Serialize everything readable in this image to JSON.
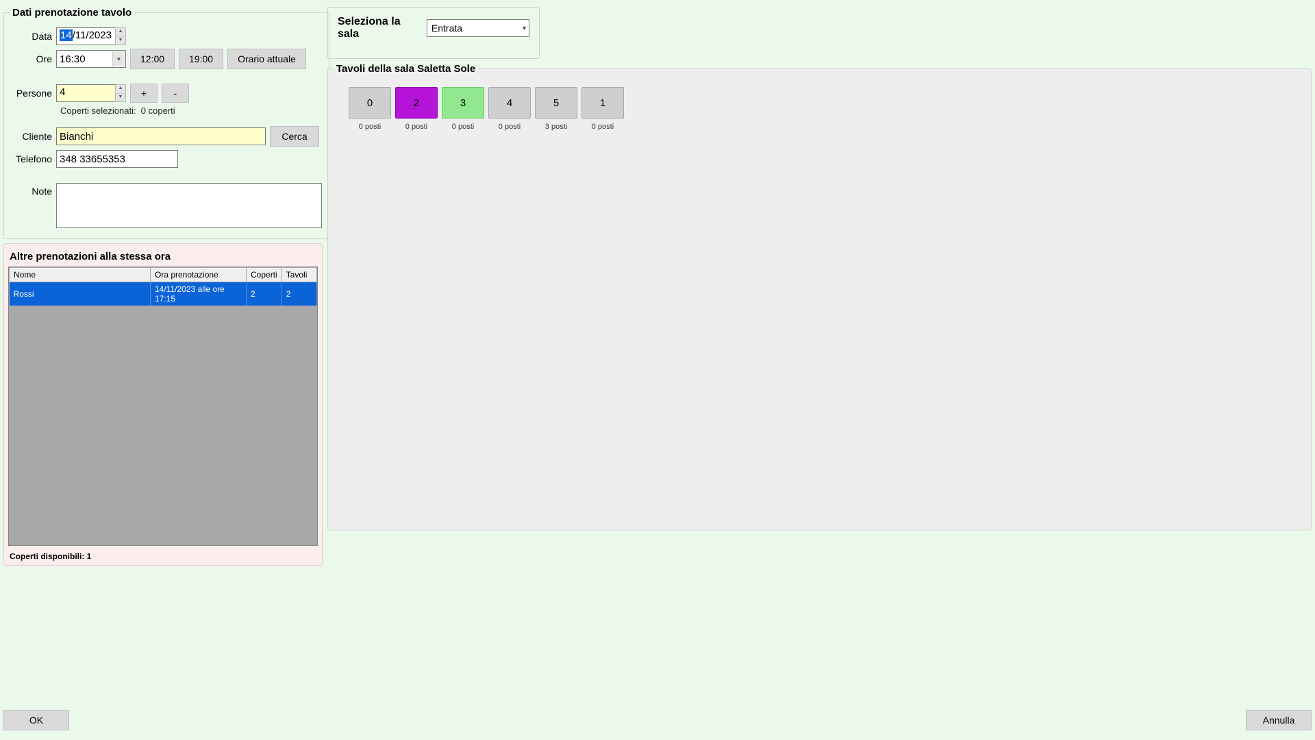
{
  "booking": {
    "section_title": "Dati prenotazione tavolo",
    "date_label": "Data",
    "date_value_sel": "14",
    "date_value_rest": "/11/2023",
    "time_label": "Ore",
    "time_value": "16:30",
    "time_btn_1": "12:00",
    "time_btn_2": "19:00",
    "time_btn_now": "Orario attuale",
    "persons_label": "Persone",
    "persons_value": "4",
    "persons_plus": "+",
    "persons_minus": "-",
    "covers_selected_label": "Coperti selezionati:",
    "covers_selected_value": "0 coperti",
    "client_label": "Cliente",
    "client_value": "Bianchi",
    "search_btn": "Cerca",
    "phone_label": "Telefono",
    "phone_value": "348 33655353",
    "notes_label": "Note",
    "notes_value": ""
  },
  "other": {
    "section_title": "Altre prenotazioni alla stessa ora",
    "col_name": "Nome",
    "col_time": "Ora prenotazione",
    "col_covers": "Coperti",
    "col_tables": "Tavoli",
    "rows": [
      {
        "name": "Rossi",
        "time": "14/11/2023 alle ore 17:15",
        "covers": "2",
        "tables": "2"
      }
    ],
    "available_label": "Coperti disponibili:",
    "available_value": "1"
  },
  "room": {
    "select_label": "Seleziona la sala",
    "select_value": "Entrata",
    "tables_title_prefix": "Tavoli della sala",
    "tables_room_name": "Saletta Sole",
    "tables": [
      {
        "num": "0",
        "seats": "0 posti",
        "state": "grey"
      },
      {
        "num": "2",
        "seats": "0 posti",
        "state": "purple"
      },
      {
        "num": "3",
        "seats": "0 posti",
        "state": "green"
      },
      {
        "num": "4",
        "seats": "0 posti",
        "state": "grey"
      },
      {
        "num": "5",
        "seats": "3 posti",
        "state": "grey"
      },
      {
        "num": "1",
        "seats": "0 posti",
        "state": "grey"
      }
    ]
  },
  "buttons": {
    "ok": "OK",
    "cancel": "Annulla"
  }
}
